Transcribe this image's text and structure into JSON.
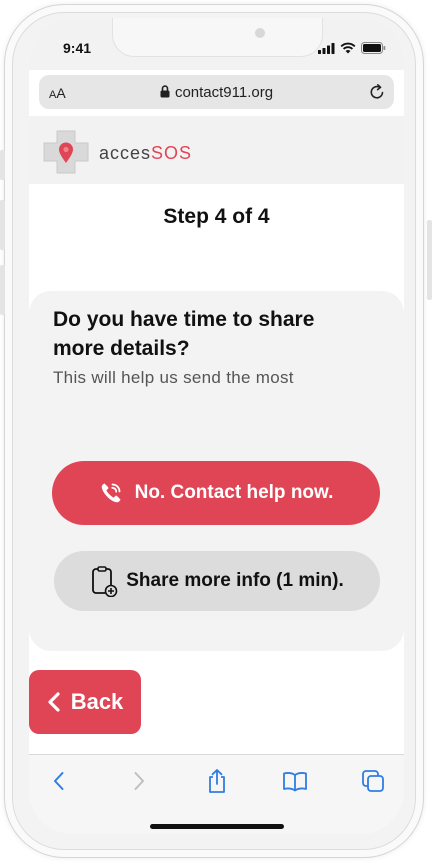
{
  "status": {
    "time": "9:41"
  },
  "browser": {
    "aa_small": "A",
    "aa_big": "A",
    "url": "contact911.org"
  },
  "brand": {
    "prefix": "acces",
    "suffix": "SOS",
    "accent": "#e04556"
  },
  "step": "Step 4 of 4",
  "card": {
    "question_line1": "Do you have time to share",
    "question_line2": "more details?",
    "subtext": "This will help us send the most",
    "primary_button": "No. Contact help now.",
    "secondary_button": "Share more info (1 min)."
  },
  "back_button": "Back",
  "toolbar": [
    "back-icon",
    "forward-icon",
    "share-icon",
    "bookmarks-icon",
    "tabs-icon"
  ]
}
